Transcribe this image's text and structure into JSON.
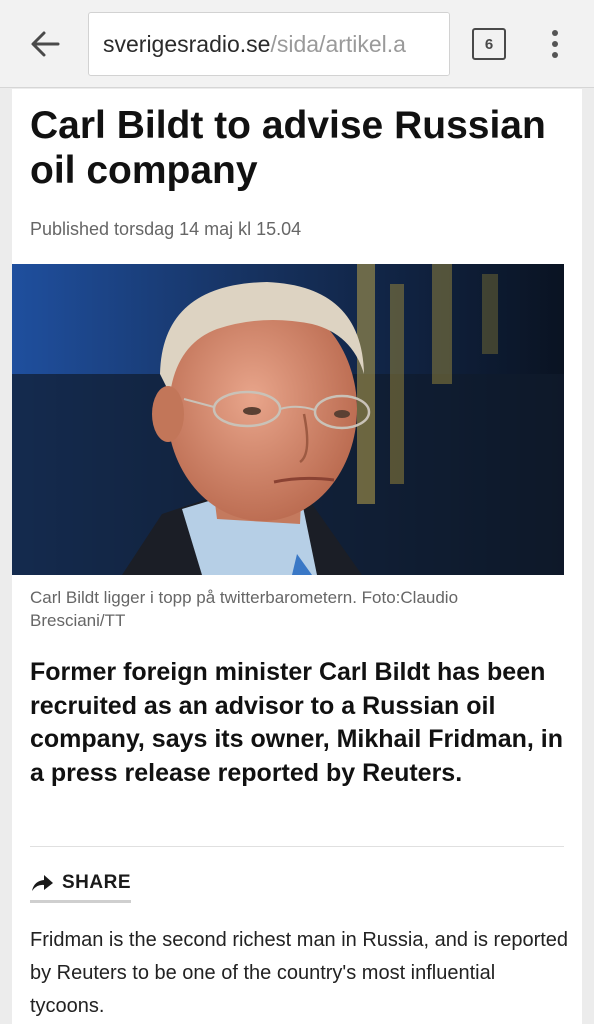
{
  "browser": {
    "url_host": "sverigesradio.se",
    "url_path": "/sida/artikel.a",
    "tab_count": "6",
    "back_icon": "arrow-left-icon",
    "menu_icon": "more-vert-icon"
  },
  "article": {
    "headline": "Carl Bildt to advise Russian oil company",
    "published": "Published torsdag 14 maj kl 15.04",
    "caption": "Carl Bildt ligger i topp på twitterbarometern. Foto:Claudio Bresciani/TT",
    "lead": "Former foreign minister Carl Bildt has been recruited as an advisor to a Russian oil company, says its owner, Mikhail Fridman, in a press release reported by Reuters.",
    "share_label": "SHARE",
    "share_icon": "share-arrow-icon",
    "body": "Fridman is the second richest man in Russia, and is reported by Reuters to be one of the country's most influential tycoons."
  },
  "colors": {
    "toolbar_bg": "#f2f2f2",
    "page_bg": "#ffffff",
    "url_path": "#9a9a9a",
    "caption": "#666666"
  }
}
